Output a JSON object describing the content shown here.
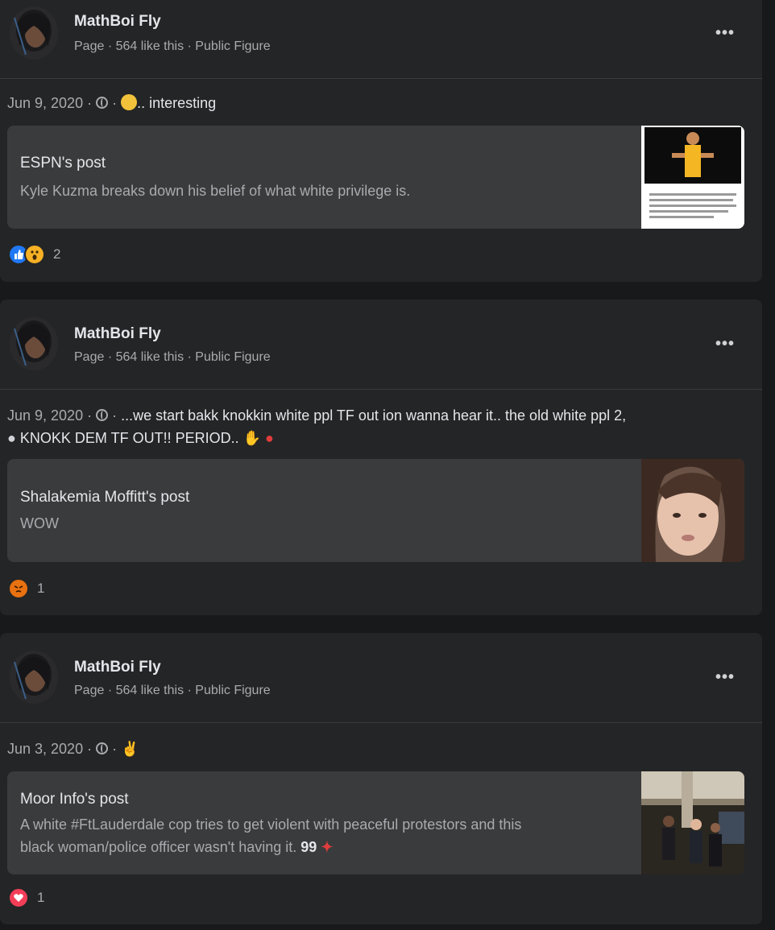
{
  "posts": [
    {
      "page_name": "MathBoi Fly",
      "page_meta": "Page · 564 like this · Public Figure",
      "date": "Jun 9, 2020 ·",
      "text": ".. interesting",
      "share": {
        "title": "ESPN's post",
        "subtitle": "Kyle Kuzma breaks down his belief of what white privilege is."
      },
      "reaction_count": "2"
    },
    {
      "page_name": "MathBoi Fly",
      "page_meta": "Page · 564 like this · Public Figure",
      "date": "Jun 9, 2020 ·",
      "text_line1": "...we start bakk knokkin white ppl TF out ion wanna hear it.. the old white ppl 2,",
      "text_line2": "KNOKK DEM TF OUT!! PERIOD..",
      "share": {
        "title": "Shalakemia Moffitt's post",
        "subtitle": "WOW"
      },
      "reaction_count": "1"
    },
    {
      "page_name": "MathBoi Fly",
      "page_meta": "Page · 564 like this · Public Figure",
      "date": "Jun 3, 2020 ·",
      "share": {
        "title": "Moor Info's post",
        "subtitle_line1": "A white #FtLauderdale cop tries to get violent with peaceful protestors and this",
        "subtitle_line2": "black woman/police officer wasn't having it."
      },
      "reaction_count": "1"
    }
  ],
  "icons": {
    "more": "more-options-icon",
    "globe": "globe-icon",
    "like": "like-reaction-icon",
    "wow": "wow-reaction-icon",
    "angry": "angry-reaction-icon",
    "love": "love-reaction-icon"
  },
  "colors": {
    "background": "#18191a",
    "card": "#242526",
    "share_box": "#3a3b3c",
    "primary_text": "#e4e6eb",
    "secondary_text": "#a8abaf"
  }
}
